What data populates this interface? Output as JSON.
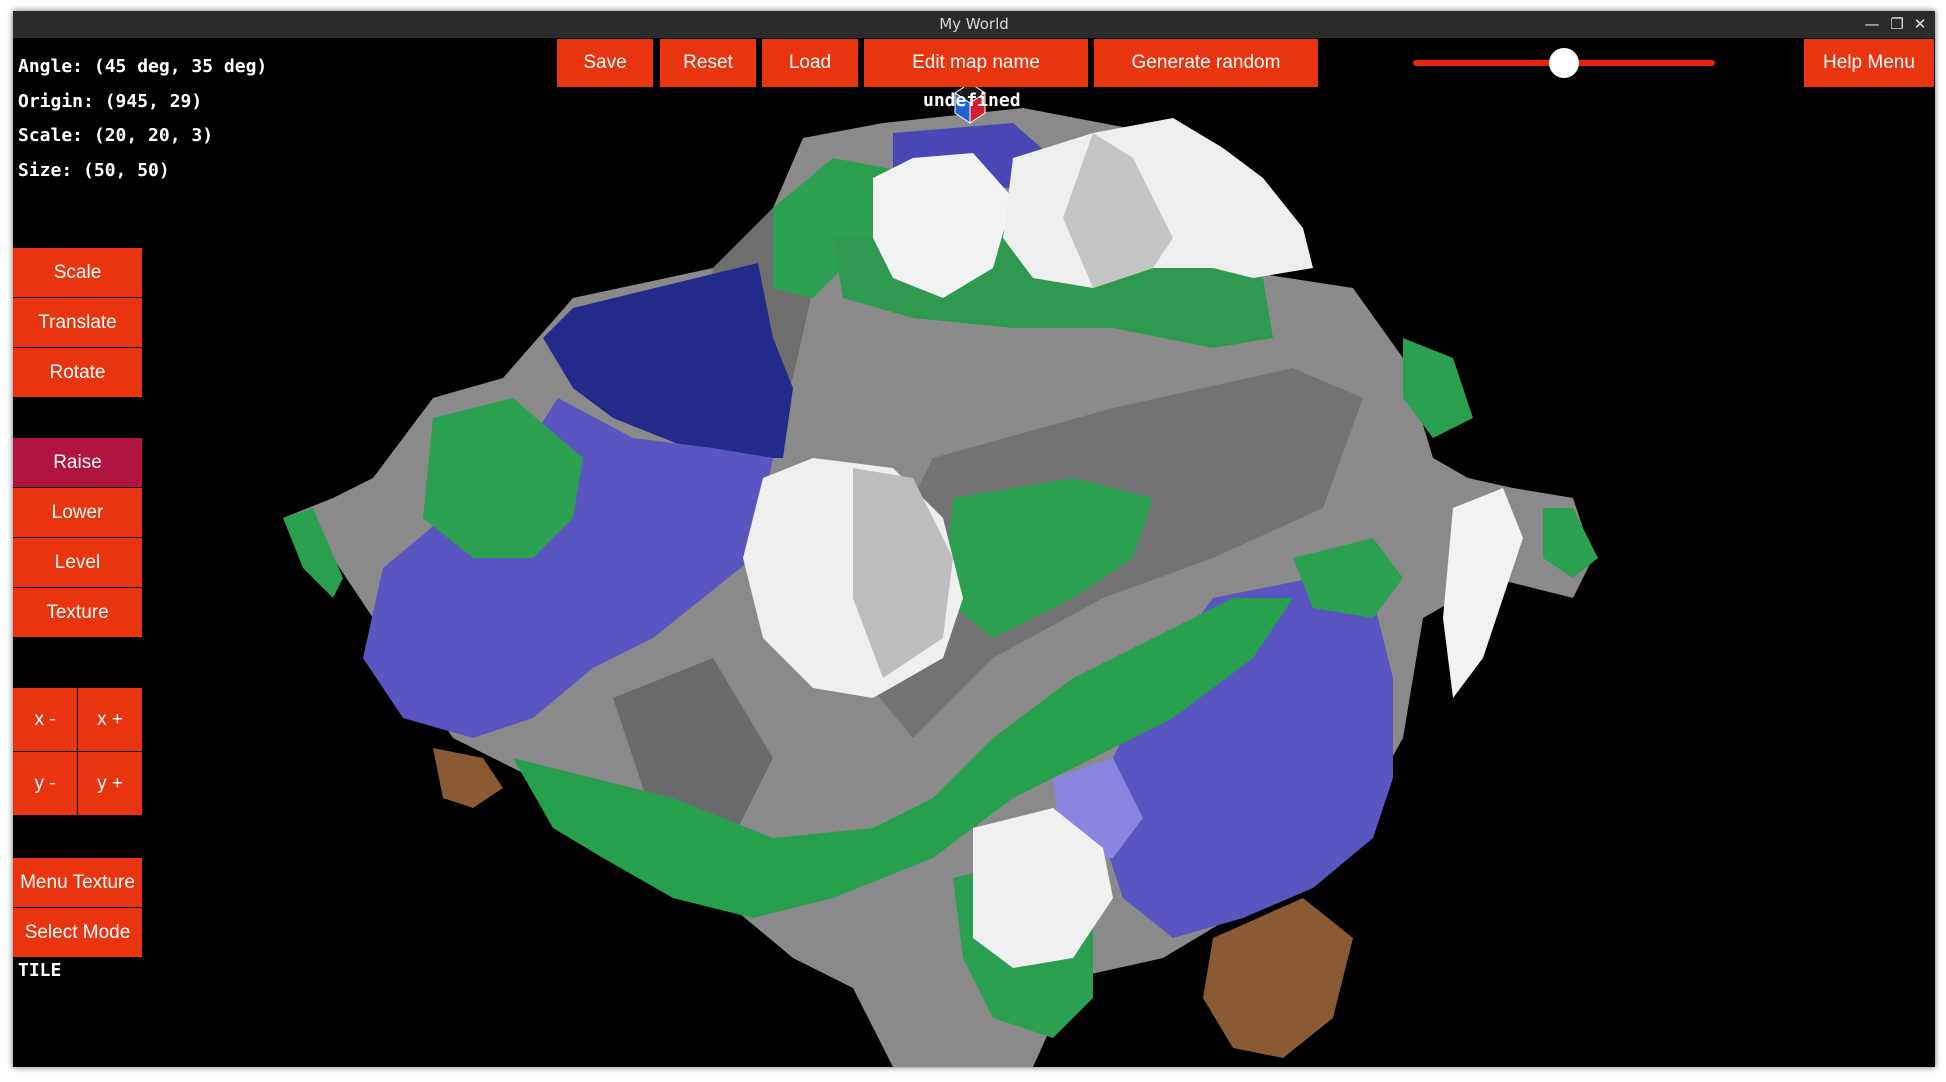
{
  "window": {
    "title": "My World"
  },
  "info": {
    "angle": "Angle: (45 deg, 35 deg)",
    "origin": "Origin: (945, 29)",
    "scale": "Scale: (20, 20, 3)",
    "size": "Size: (50, 50)"
  },
  "toolbar": {
    "save": "Save",
    "reset": "Reset",
    "load": "Load",
    "edit_map_name": "Edit map name",
    "generate_random": "Generate random",
    "help_menu": "Help Menu"
  },
  "zoom_slider": {
    "value_fraction": 0.5
  },
  "map_name": "undefined",
  "transform_buttons": {
    "scale": "Scale",
    "translate": "Translate",
    "rotate": "Rotate"
  },
  "edit_buttons": {
    "raise": "Raise",
    "lower": "Lower",
    "level": "Level",
    "texture": "Texture",
    "active": "Raise"
  },
  "axis_buttons": {
    "x_minus": "x -",
    "x_plus": "x +",
    "y_minus": "y -",
    "y_plus": "y +"
  },
  "menu_buttons": {
    "menu_texture": "Menu Texture",
    "select_mode": "Select Mode"
  },
  "select_mode_status": "TILE",
  "colors": {
    "button": "#e8340f",
    "button_active": "#b0143f",
    "water": "#5a55c0",
    "grass": "#2aa050",
    "rock": "#8a8a8a",
    "snow": "#f2f2f2",
    "dirt": "#8a5a35",
    "background": "#000000"
  },
  "icons": {
    "window_minimize": "minimize-icon",
    "window_maximize": "maximize-icon",
    "window_close": "close-icon",
    "axis_gizmo": "cube-gizmo-icon"
  }
}
